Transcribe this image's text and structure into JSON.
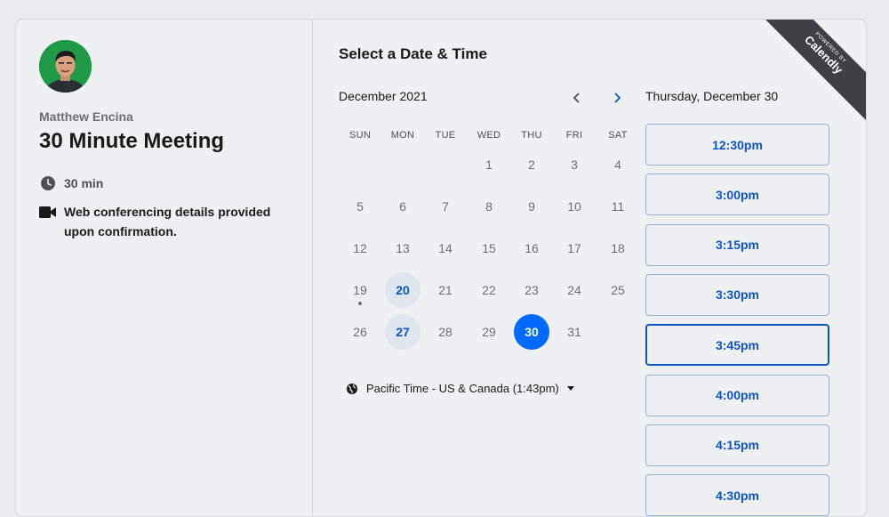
{
  "host": {
    "name": "Matthew Encina"
  },
  "event": {
    "title": "30 Minute Meeting",
    "duration": "30 min",
    "conferencing": "Web conferencing details provided upon confirmation."
  },
  "scheduler": {
    "title": "Select a Date & Time",
    "month": "December 2021",
    "weekdays": [
      "SUN",
      "MON",
      "TUE",
      "WED",
      "THU",
      "FRI",
      "SAT"
    ],
    "weeks": [
      [
        "",
        "",
        "",
        "1",
        "2",
        "3",
        "4"
      ],
      [
        "5",
        "6",
        "7",
        "8",
        "9",
        "10",
        "11"
      ],
      [
        "12",
        "13",
        "14",
        "15",
        "16",
        "17",
        "18"
      ],
      [
        "19",
        "20",
        "21",
        "22",
        "23",
        "24",
        "25"
      ],
      [
        "26",
        "27",
        "28",
        "29",
        "30",
        "31",
        ""
      ]
    ],
    "available_days": [
      "20",
      "27"
    ],
    "selected_day": "30",
    "today": "19",
    "timezone": "Pacific Time - US & Canada (1:43pm)"
  },
  "slots": {
    "date_label": "Thursday, December 30",
    "times": [
      "12:30pm",
      "3:00pm",
      "3:15pm",
      "3:30pm",
      "3:45pm",
      "4:00pm",
      "4:15pm",
      "4:30pm"
    ],
    "hovered": "3:45pm"
  },
  "badge": {
    "top": "POWERED BY",
    "brand": "Calendly"
  },
  "colors": {
    "accent": "#0069ff",
    "link": "#0b55c2",
    "available_bg": "#dfe6ef",
    "avatar_bg": "#1f9a47"
  }
}
